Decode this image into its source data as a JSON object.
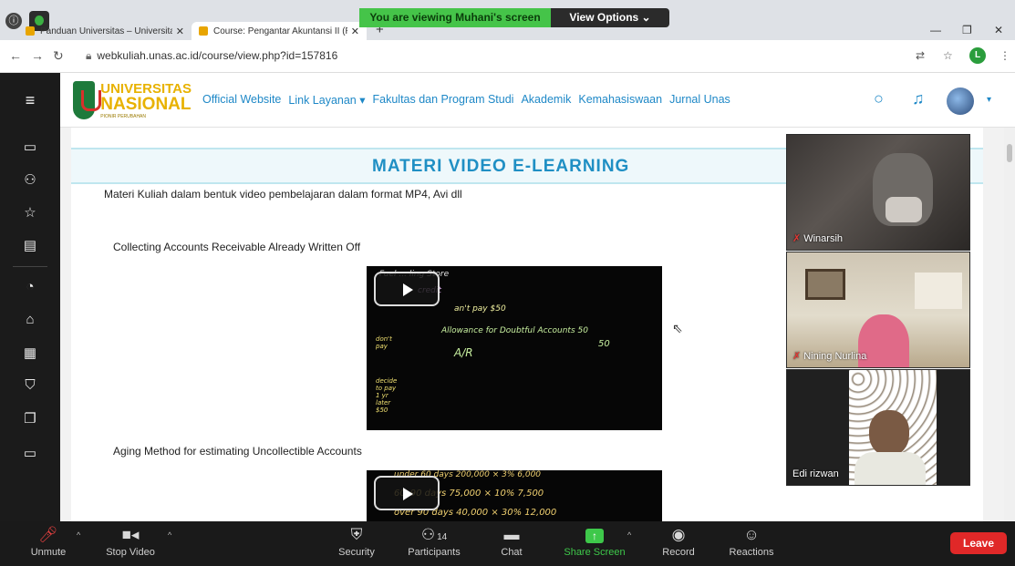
{
  "zoom_banner": {
    "recording": "",
    "sharing_text": "You are viewing Muhani's screen",
    "view_options": "View Options ⌄"
  },
  "browser": {
    "tabs": [
      {
        "label": "Panduan Universitas – Universita"
      },
      {
        "label": "Course: Pengantar Akuntansi II (R"
      }
    ],
    "new_tab": "+",
    "url": "webkuliah.unas.ac.id/course/view.php?id=157816",
    "profile_initial": "L"
  },
  "site": {
    "logo": {
      "line1": "UNIVERSITAS",
      "line2": "NASIONAL",
      "line3": "PIONIR PERUBAHAN"
    },
    "menu": [
      "Official Website",
      "Link Layanan ▾",
      "Fakultas dan Program Studi",
      "Akademik",
      "Kemahasiswaan",
      "Jurnal Unas"
    ]
  },
  "content": {
    "heading": "MATERI VIDEO E-LEARNING",
    "description": "Materi Kuliah dalam bentuk video pembelajaran dalam format MP4, Avi dll",
    "videos": [
      {
        "title": "Collecting Accounts Receivable Already Written Off",
        "chalk": {
          "a": "Fuel ... ling Store",
          "b": "credit",
          "c": "an't pay $50",
          "d": "Allowance for Doubtful Accounts  50",
          "e": "50",
          "f": "A/R",
          "g": "don't pay",
          "h": "decide to pay 1 yr later $50"
        }
      },
      {
        "title": "Aging Method for estimating Uncollectible Accounts",
        "chalk": {
          "r1": "under 60 days   200,000  ×  3%     6,000",
          "r2": "60–90 days     75,000  ×  10%     7,500",
          "r3": "over 90 days   40,000  ×  30%    12,000"
        }
      }
    ]
  },
  "participants_tiles": [
    {
      "name": "Winarsih"
    },
    {
      "name": "Nining Nurlina"
    },
    {
      "name": "Edi rizwan"
    }
  ],
  "zoom_toolbar": {
    "unmute": "Unmute",
    "stop_video": "Stop Video",
    "security": "Security",
    "participants": "Participants",
    "participants_count": "14",
    "chat": "Chat",
    "share_screen": "Share Screen",
    "record": "Record",
    "reactions": "Reactions",
    "leave": "Leave"
  },
  "colors": {
    "accent_blue": "#1f8fc4",
    "zoom_green": "#45c449",
    "leave_red": "#e02828"
  }
}
